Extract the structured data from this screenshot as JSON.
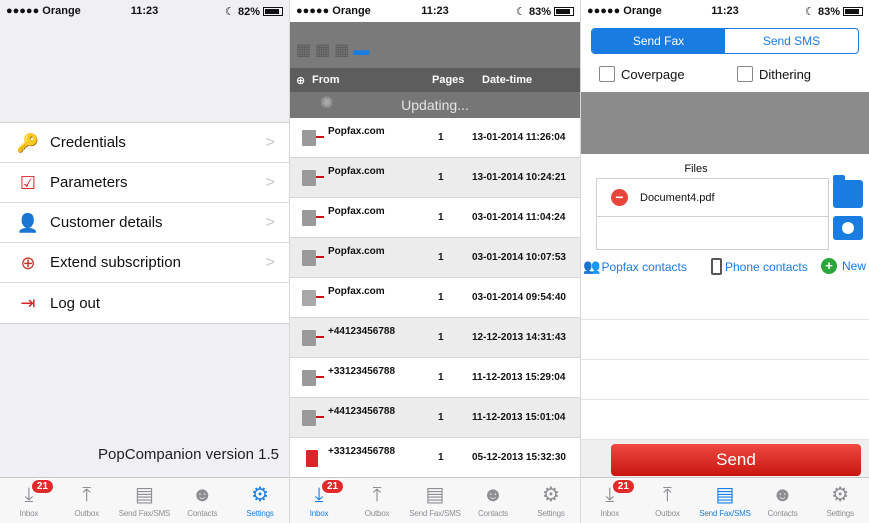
{
  "status_bars": [
    {
      "carrier": "●●●●● Orange",
      "time": "11:23",
      "battery": "82%"
    },
    {
      "carrier": "●●●●● Orange",
      "time": "11:23",
      "battery": "83%"
    },
    {
      "carrier": "●●●●● Orange",
      "time": "11:23",
      "battery": "83%"
    }
  ],
  "tabbar": {
    "badge": "21",
    "tabs": [
      {
        "label": "Inbox",
        "icon": "inbox-download-icon"
      },
      {
        "label": "Outbox",
        "icon": "outbox-upload-icon"
      },
      {
        "label": "Send Fax/SMS",
        "icon": "document-icon"
      },
      {
        "label": "Contacts",
        "icon": "contacts-icon"
      },
      {
        "label": "Settings",
        "icon": "gear-icon"
      }
    ],
    "active_color": "#1a80e5"
  },
  "settings": {
    "menu": [
      {
        "label": "Credentials",
        "icon": "key-lock-icon"
      },
      {
        "label": "Parameters",
        "icon": "checkmark-icon"
      },
      {
        "label": "Customer details",
        "icon": "user-info-icon"
      },
      {
        "label": "Extend subscription",
        "icon": "compass-icon"
      },
      {
        "label": "Log out",
        "icon": "exit-door-icon"
      }
    ],
    "version": "PopCompanion version 1.5"
  },
  "inbox": {
    "columns": {
      "from": "From",
      "pages": "Pages",
      "datetime": "Date-time"
    },
    "updating": "Updating...",
    "rows": [
      {
        "from": "Popfax.com",
        "pages": "1",
        "datetime": "13-01-2014 11:26:04"
      },
      {
        "from": "Popfax.com",
        "pages": "1",
        "datetime": "13-01-2014 10:24:21"
      },
      {
        "from": "Popfax.com",
        "pages": "1",
        "datetime": "03-01-2014 11:04:24"
      },
      {
        "from": "Popfax.com",
        "pages": "1",
        "datetime": "03-01-2014 10:07:53"
      },
      {
        "from": "Popfax.com",
        "pages": "1",
        "datetime": "03-01-2014 09:54:40"
      },
      {
        "from": "+44123456788",
        "pages": "1",
        "datetime": "12-12-2013 14:31:43"
      },
      {
        "from": "+33123456788",
        "pages": "1",
        "datetime": "11-12-2013 15:29:04"
      },
      {
        "from": "+44123456788",
        "pages": "1",
        "datetime": "11-12-2013 15:01:04"
      },
      {
        "from": "+33123456788",
        "pages": "1",
        "datetime": "05-12-2013 15:32:30"
      }
    ]
  },
  "send": {
    "tabs": {
      "fax": "Send Fax",
      "sms": "Send SMS"
    },
    "coverpage": "Coverpage",
    "dithering": "Dithering",
    "files_title": "Files",
    "file": "Document4.pdf",
    "popfax_contacts": "Popfax contacts",
    "phone_contacts": "Phone contacts",
    "new": "New",
    "send_button": "Send",
    "accent": "#1a7be0",
    "send_color": "#d9231c"
  }
}
